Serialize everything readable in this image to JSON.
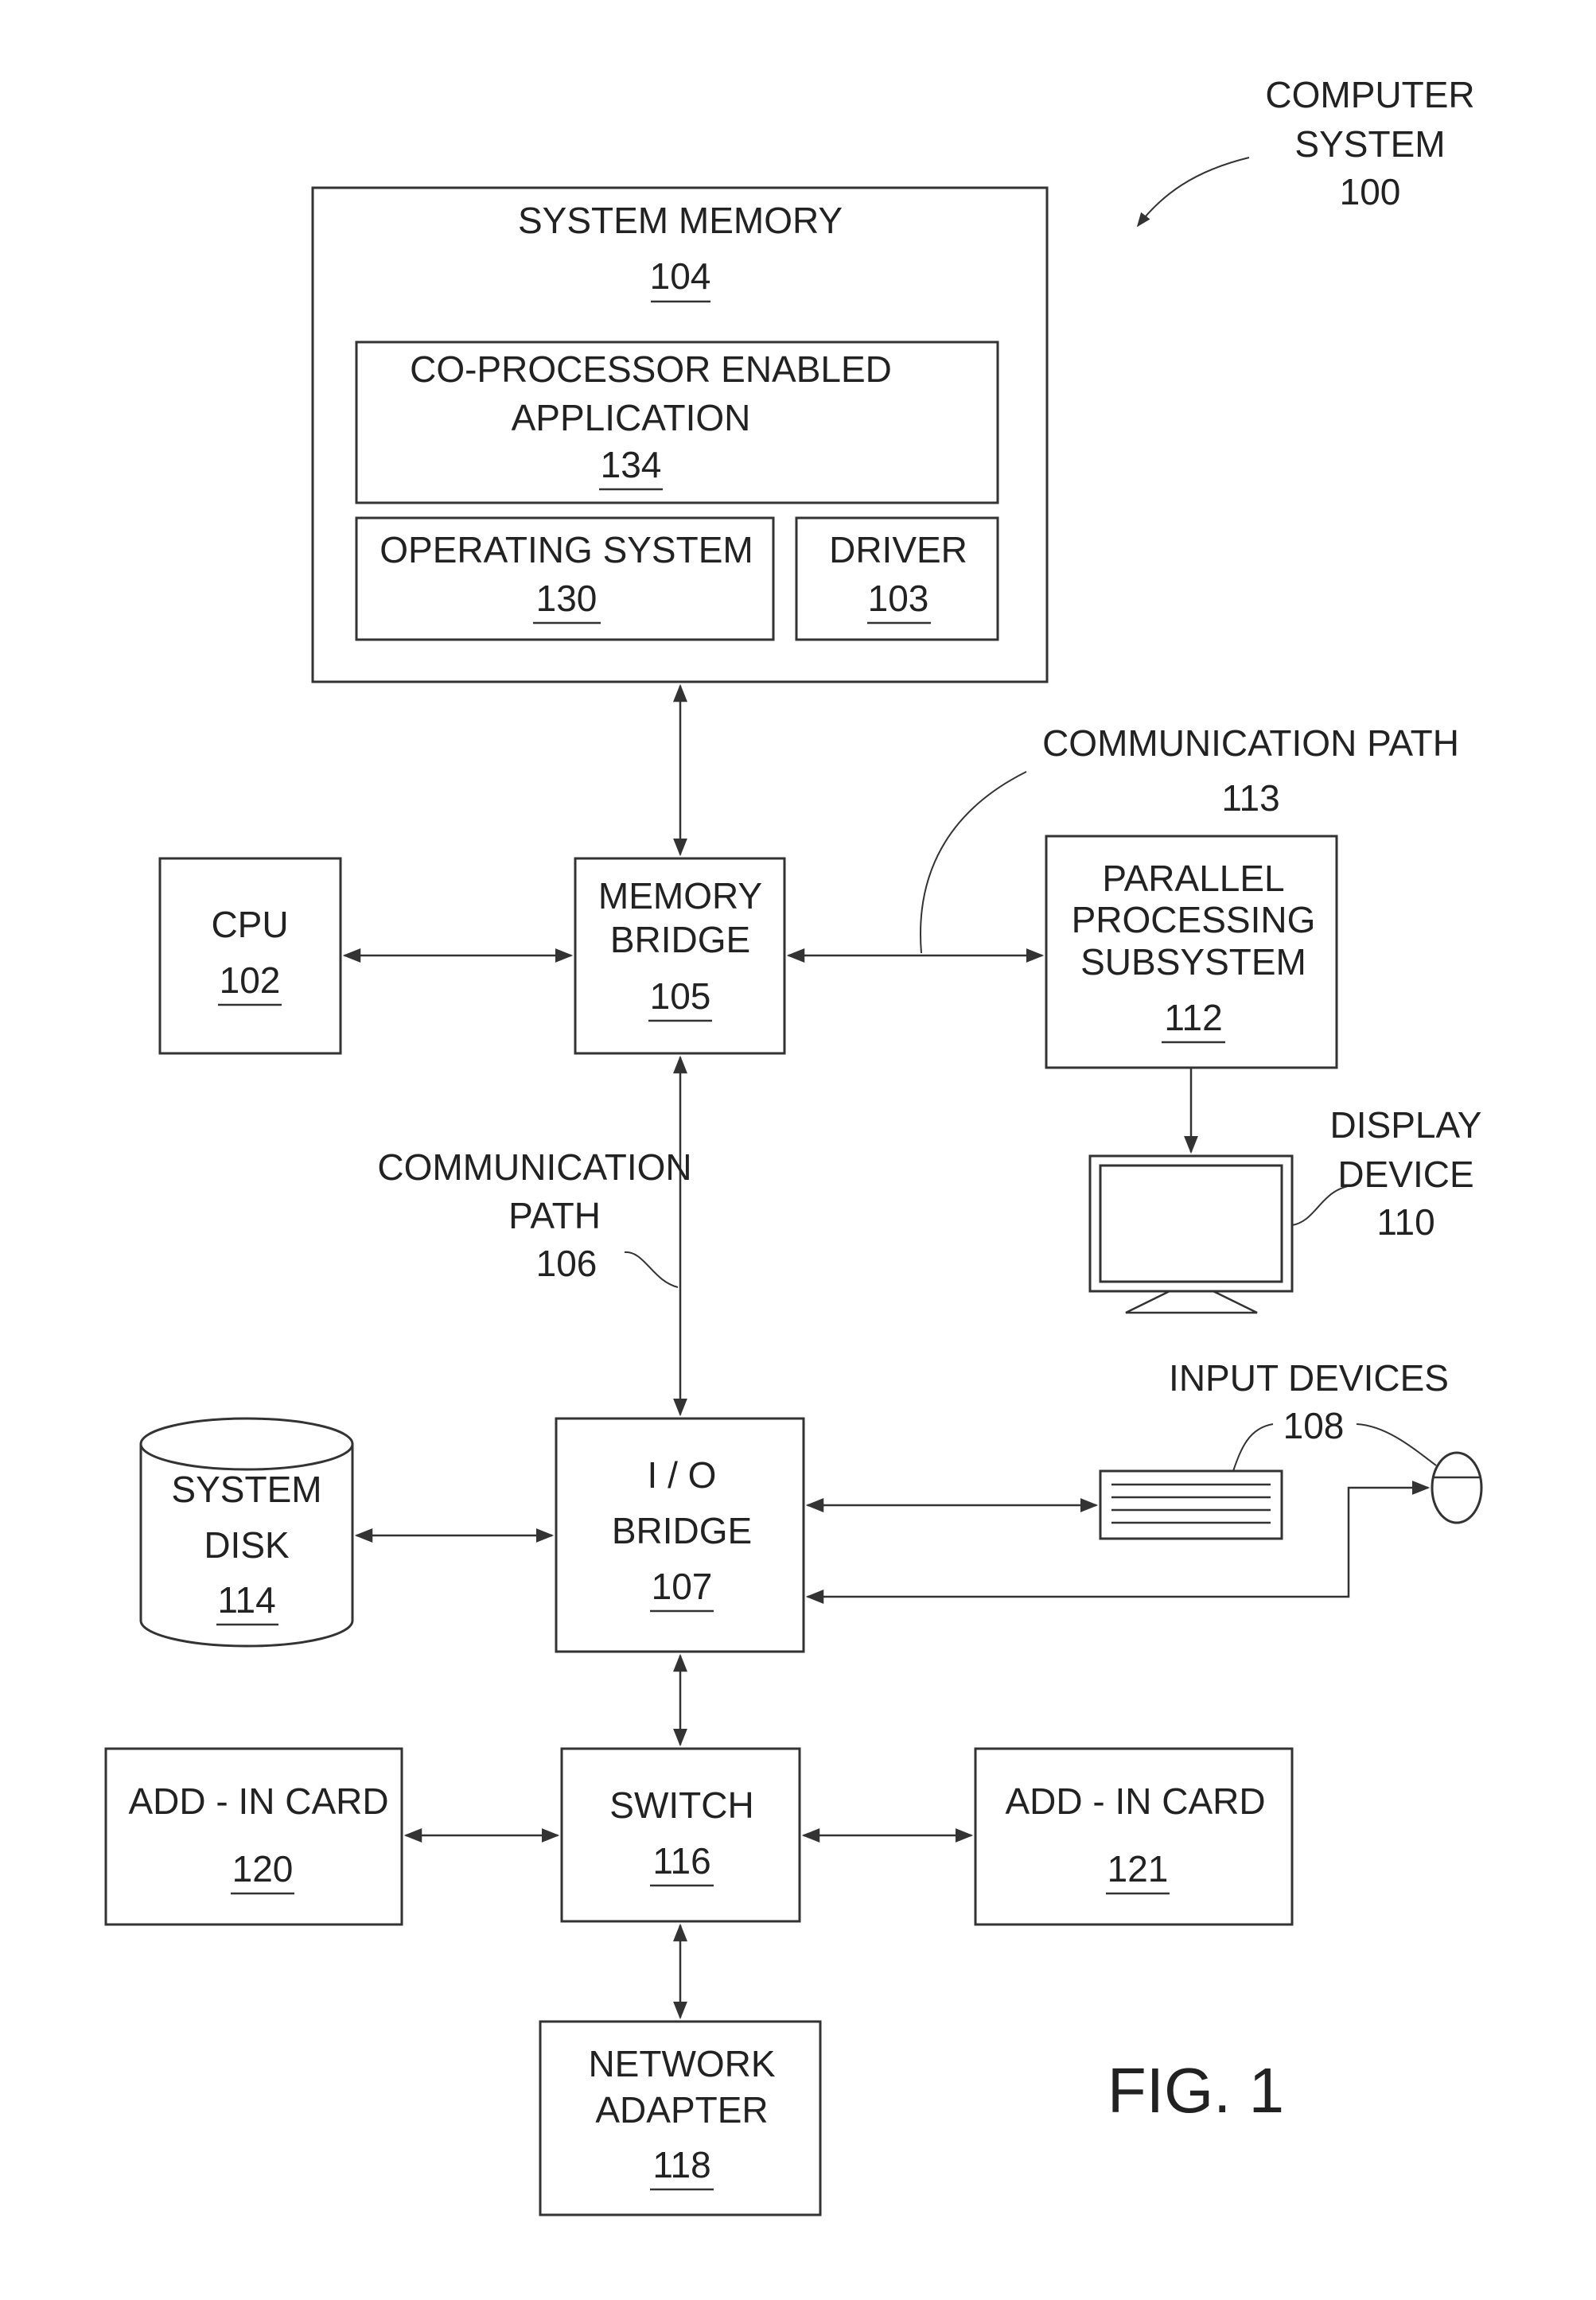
{
  "figure": {
    "caption": "FIG. 1",
    "system_label": {
      "lines": [
        "COMPUTER",
        "SYSTEM"
      ],
      "ref": "100"
    }
  },
  "blocks": {
    "system_memory": {
      "lines": [
        "SYSTEM MEMORY"
      ],
      "ref": "104"
    },
    "coprocessor_app": {
      "lines": [
        "CO-PROCESSOR ENABLED",
        "APPLICATION"
      ],
      "ref": "134"
    },
    "operating_system": {
      "lines": [
        "OPERATING SYSTEM"
      ],
      "ref": "130"
    },
    "driver": {
      "lines": [
        "DRIVER"
      ],
      "ref": "103"
    },
    "cpu": {
      "lines": [
        "CPU"
      ],
      "ref": "102"
    },
    "memory_bridge": {
      "lines": [
        "MEMORY",
        "BRIDGE"
      ],
      "ref": "105"
    },
    "parallel_processing": {
      "lines": [
        "PARALLEL",
        "PROCESSING",
        "SUBSYSTEM"
      ],
      "ref": "112"
    },
    "io_bridge": {
      "lines": [
        "I / O",
        "BRIDGE"
      ],
      "ref": "107"
    },
    "system_disk": {
      "lines": [
        "SYSTEM",
        "DISK"
      ],
      "ref": "114"
    },
    "switch": {
      "lines": [
        "SWITCH"
      ],
      "ref": "116"
    },
    "addin_card_120": {
      "lines": [
        "ADD - IN CARD"
      ],
      "ref": "120"
    },
    "addin_card_121": {
      "lines": [
        "ADD - IN CARD"
      ],
      "ref": "121"
    },
    "network_adapter": {
      "lines": [
        "NETWORK",
        "ADAPTER"
      ],
      "ref": "118"
    }
  },
  "callouts": {
    "comm_path_113": {
      "lines": [
        "COMMUNICATION PATH"
      ],
      "ref": "113"
    },
    "comm_path_106": {
      "lines": [
        "COMMUNICATION",
        "PATH"
      ],
      "ref": "106"
    },
    "display_device": {
      "lines": [
        "DISPLAY",
        "DEVICE"
      ],
      "ref": "110"
    },
    "input_devices": {
      "lines": [
        "INPUT  DEVICES"
      ],
      "ref": "108"
    }
  }
}
